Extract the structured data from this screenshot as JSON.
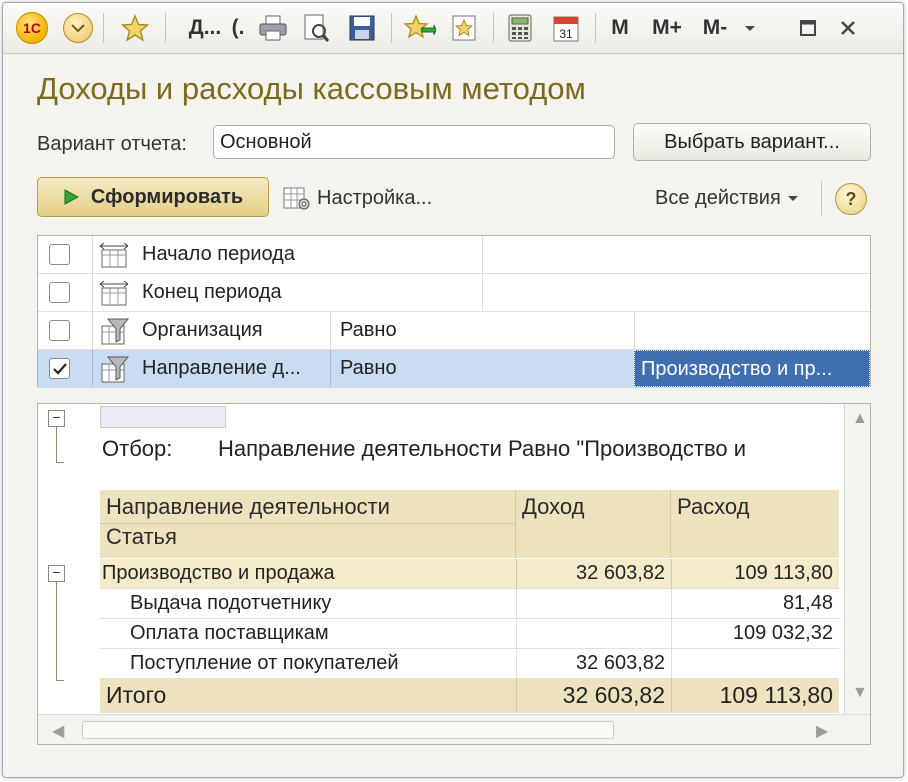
{
  "toolbar": {
    "logo": "1С",
    "doc_short": "Д...",
    "doc_short2": "(.",
    "m_label": "M",
    "m_plus_label": "M+",
    "m_minus_label": "M-",
    "calendar_day": "31",
    "icons": [
      "1c-logo-icon",
      "dropdown-menu-icon",
      "star-icon",
      "printer-icon",
      "print-preview-icon",
      "save-icon",
      "favorite-add-icon",
      "favorite-icon",
      "calculator-icon",
      "calendar-icon",
      "chevron-down-icon",
      "maximize-icon",
      "close-icon"
    ]
  },
  "report_form": {
    "title": "Доходы и расходы кассовым методом",
    "variant_label": "Вариант отчета:",
    "variant_value": "Основной",
    "choose_variant_button": "Выбрать вариант...",
    "generate_button": "Сформировать",
    "settings_button": "Настройка...",
    "all_actions": "Все действия",
    "help": "?"
  },
  "filters": [
    {
      "checked": false,
      "name": "Начало периода",
      "condition": "",
      "value": ""
    },
    {
      "checked": false,
      "name": "Конец периода",
      "condition": "",
      "value": ""
    },
    {
      "checked": false,
      "name": "Организация",
      "condition": "Равно",
      "value": ""
    },
    {
      "checked": true,
      "name": "Направление д...",
      "condition": "Равно",
      "value": "Производство и пр..."
    }
  ],
  "report": {
    "otbor_label": "Отбор:",
    "otbor_value": "Направление деятельности Равно \"Производство и",
    "headers": {
      "col1_line1": "Направление деятельности",
      "col1_line2": "Статья",
      "col2": "Доход",
      "col3": "Расход"
    },
    "rows": [
      {
        "name": "Производство и продажа",
        "income": "32 603,82",
        "expense": "109 113,80"
      },
      {
        "name": "Выдача подотчетнику",
        "income": "",
        "expense": "81,48"
      },
      {
        "name": "Оплата поставщикам",
        "income": "",
        "expense": "109 032,32"
      },
      {
        "name": "Поступление от покупателей",
        "income": "32 603,82",
        "expense": ""
      }
    ],
    "total": {
      "name": "Итого",
      "income": "32 603,82",
      "expense": "109 113,80"
    }
  },
  "colors": {
    "title": "#7d6a1c",
    "header_bg": "#ede3bf",
    "selected_row": "#c9dcf2",
    "selected_cell": "#3f6fb0"
  }
}
